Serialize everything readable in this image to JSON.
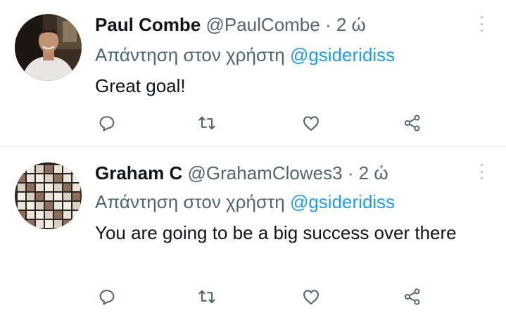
{
  "tweets": [
    {
      "name": "Paul Combe",
      "handle": "@PaulCombe",
      "separator": "·",
      "time": "2 ώ",
      "reply_prefix": "Απάντηση στον χρήστη",
      "reply_mention": "@gsideridiss",
      "text": "Great goal!",
      "avatar_icon": "profile-photo-man"
    },
    {
      "name": "Graham C",
      "handle": "@GrahamClowes3",
      "separator": "·",
      "time": "2 ώ",
      "reply_prefix": "Απάντηση στον χρήστη",
      "reply_mention": "@gsideridiss",
      "text": "You are going to be a big success over there",
      "avatar_icon": "profile-photo-mosaic"
    }
  ],
  "actions": [
    "reply-icon",
    "retweet-icon",
    "like-icon",
    "share-icon"
  ],
  "colors": {
    "text": "#0f1419",
    "secondary": "#536471",
    "accent": "#1d9bf0",
    "divider": "#e6ecf0"
  }
}
